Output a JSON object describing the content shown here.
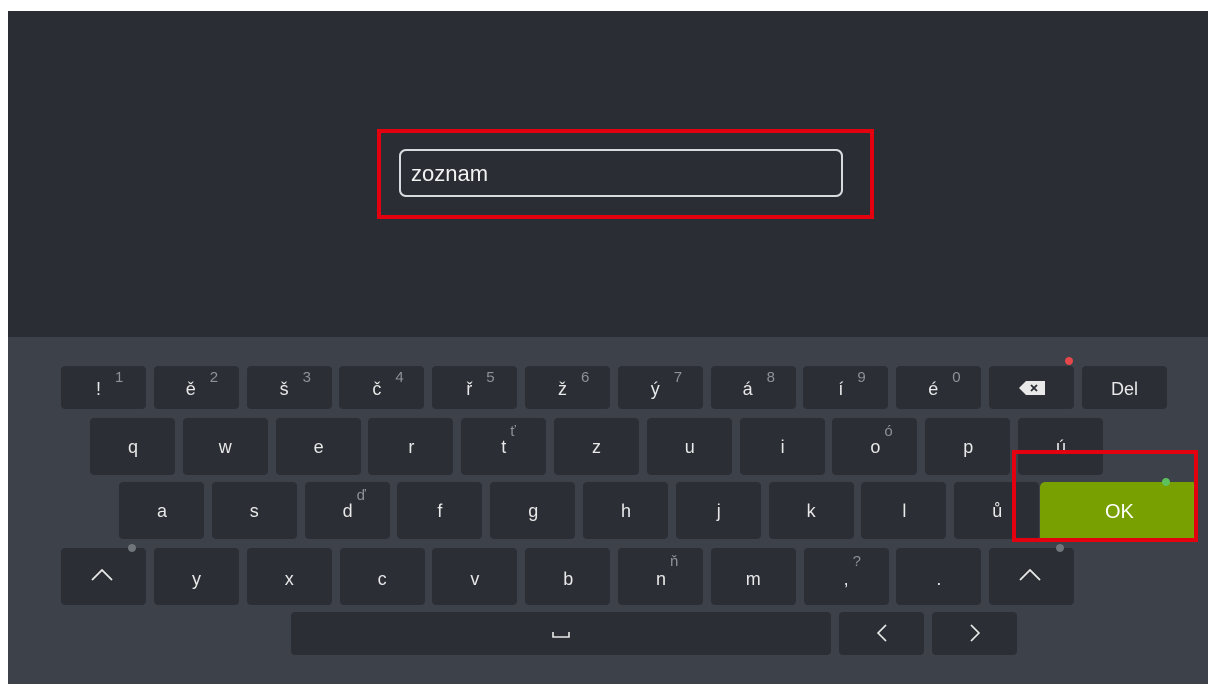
{
  "search": {
    "value": "zoznam"
  },
  "keyboard": {
    "row1": [
      {
        "main": "!",
        "sub": "1"
      },
      {
        "main": "ě",
        "sub": "2"
      },
      {
        "main": "š",
        "sub": "3"
      },
      {
        "main": "č",
        "sub": "4"
      },
      {
        "main": "ř",
        "sub": "5"
      },
      {
        "main": "ž",
        "sub": "6"
      },
      {
        "main": "ý",
        "sub": "7"
      },
      {
        "main": "á",
        "sub": "8"
      },
      {
        "main": "í",
        "sub": "9"
      },
      {
        "main": "é",
        "sub": "0"
      }
    ],
    "backspace_icon": "backspace-icon",
    "del_label": "Del",
    "row2": [
      {
        "main": "q"
      },
      {
        "main": "w"
      },
      {
        "main": "e"
      },
      {
        "main": "r"
      },
      {
        "main": "t",
        "sub": "ť"
      },
      {
        "main": "z"
      },
      {
        "main": "u"
      },
      {
        "main": "i"
      },
      {
        "main": "o",
        "sub": "ó"
      },
      {
        "main": "p"
      },
      {
        "main": "ú"
      }
    ],
    "row3": [
      {
        "main": "a"
      },
      {
        "main": "s"
      },
      {
        "main": "d",
        "sub": "ď"
      },
      {
        "main": "f"
      },
      {
        "main": "g"
      },
      {
        "main": "h"
      },
      {
        "main": "j"
      },
      {
        "main": "k"
      },
      {
        "main": "l"
      },
      {
        "main": "ů"
      }
    ],
    "ok_label": "OK",
    "row4": [
      {
        "main": "y"
      },
      {
        "main": "x"
      },
      {
        "main": "c"
      },
      {
        "main": "v"
      },
      {
        "main": "b"
      },
      {
        "main": "n",
        "sub": "ň"
      },
      {
        "main": "m"
      },
      {
        "main": ",",
        "sub": "?"
      },
      {
        "main": "."
      }
    ],
    "shift_icon": "caret-up-icon",
    "space_icon": "space-bar-icon",
    "left_icon": "chevron-left-icon",
    "right_icon": "chevron-right-icon",
    "colors": {
      "ok": "#78a000",
      "indicator_red": "#e5474b",
      "indicator_green": "#5cc05c",
      "highlight": "#e3000f"
    }
  }
}
